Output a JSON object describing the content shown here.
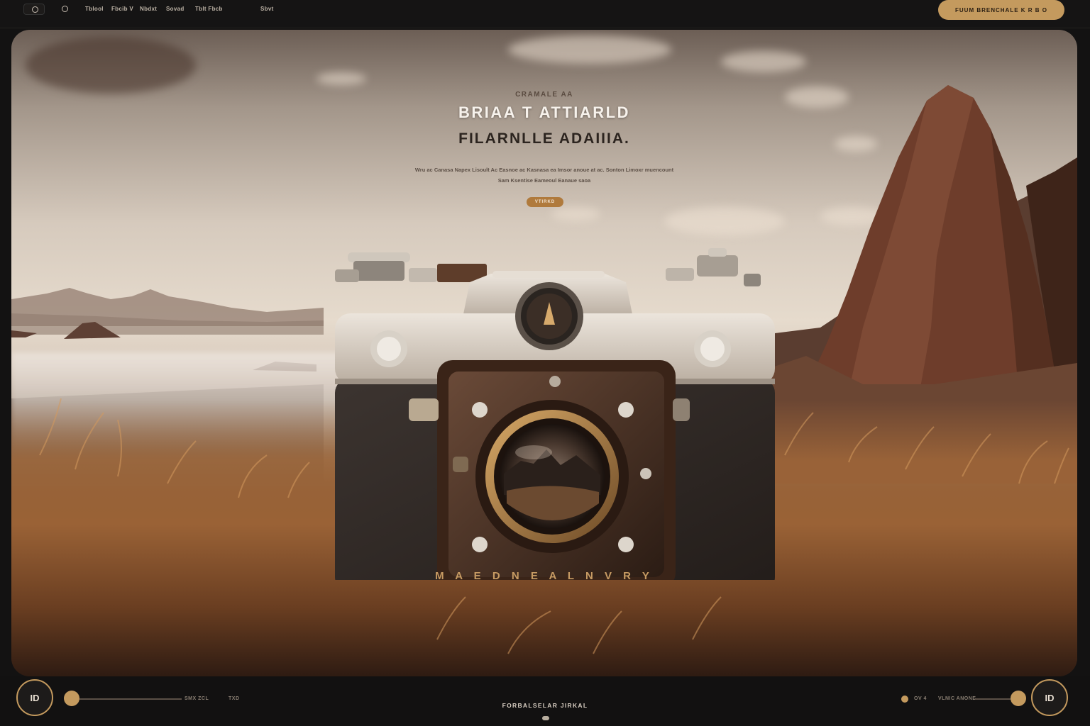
{
  "topbar": {
    "nav": [
      "Tblool",
      "Fbcib V",
      "Nbdxt",
      "Sovad",
      "Tblt Fbcb",
      "Sbvt"
    ],
    "cta_label": "FUUM BRENCHALE K R B O"
  },
  "hero": {
    "eyebrow": "CRAMALE AA",
    "title_line1": "BRIAA T ATTIARLD",
    "title_line2": "FILARNLLE ADAIIIA.",
    "description": "Wru ac Canasa Napex Lisoult Ac Easnoe ac Kasnasa ea Imsor anoue at ac. Sonton Limoxr muencount Sam Ksentise Eameoul Eanaue saoa",
    "button_label": "VTIRKD",
    "caption": "M A E D N E A L   N V R Y"
  },
  "footer": {
    "left_button": "ID",
    "right_button": "ID",
    "left_meta_1": "SMX ZCL",
    "left_meta_2": "TXD",
    "right_meta_1": "OV 4",
    "right_meta_2": "VLNIC ANONE",
    "title": "FORBALSELAR JIRKAL"
  },
  "colors": {
    "accent": "#c49a5e",
    "background": "#131212",
    "grass": "#9a6236"
  }
}
